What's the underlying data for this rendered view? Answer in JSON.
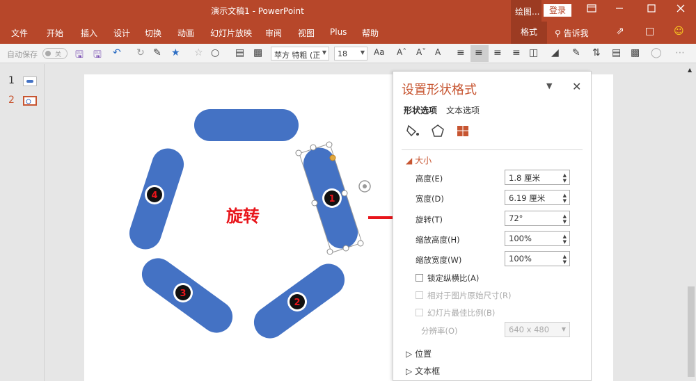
{
  "window": {
    "title": "演示文稿1  -  PowerPoint",
    "context_tab": "绘图...",
    "login": "登录",
    "controls": [
      "ribbon-display-icon",
      "minimize-icon",
      "maximize-icon",
      "close-icon"
    ]
  },
  "menu": {
    "tabs": [
      "文件",
      "开始",
      "插入",
      "设计",
      "切换",
      "动画",
      "幻灯片放映",
      "审阅",
      "视图",
      "Plus",
      "帮助"
    ],
    "format_tab": "格式",
    "tell_me": "告诉我"
  },
  "toolbar": {
    "autosave_label": "自动保存",
    "autosave_state": "关",
    "font_name": "苹方 特粗 (正",
    "font_size": "18"
  },
  "slides": {
    "items": [
      {
        "num": "1"
      },
      {
        "num": "2"
      }
    ],
    "selected": 2
  },
  "canvas": {
    "annotation_text": "旋转",
    "shape_color": "#4472c4",
    "badges": [
      "1",
      "2",
      "3",
      "4"
    ],
    "arrow_color": "#e8151b"
  },
  "format_pane": {
    "title": "设置形状格式",
    "tabs": [
      "形状选项",
      "文本选项"
    ],
    "section_size": "大小",
    "fields": [
      {
        "label": "高度(E)",
        "value": "1.8 厘米"
      },
      {
        "label": "宽度(D)",
        "value": "6.19 厘米"
      },
      {
        "label": "旋转(T)",
        "value": "72°"
      },
      {
        "label": "缩放高度(H)",
        "value": "100%"
      },
      {
        "label": "缩放宽度(W)",
        "value": "100%"
      }
    ],
    "checkboxes": [
      {
        "label": "锁定纵横比(A)",
        "enabled": true
      },
      {
        "label": "相对于图片原始尺寸(R)",
        "enabled": false
      },
      {
        "label": "幻灯片最佳比例(B)",
        "enabled": false
      }
    ],
    "resolution_label": "分辨率(O)",
    "resolution_value": "640 x 480",
    "section_position": "位置",
    "section_textbox": "文本框"
  }
}
